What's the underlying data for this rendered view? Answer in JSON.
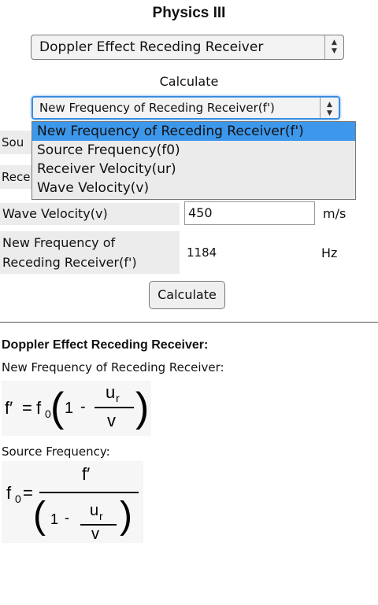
{
  "app": {
    "title": "Physics III"
  },
  "topic_select": {
    "value": "Doppler Effect Receding Receiver"
  },
  "calculate_label": "Calculate",
  "calc_select": {
    "value": "New Frequency of Receding Receiver(f')"
  },
  "dropdown": {
    "options": [
      "New Frequency of Receding Receiver(f')",
      "Source Frequency(f0)",
      "Receiver Velocity(ur)",
      "Wave Velocity(v)"
    ]
  },
  "form": {
    "row1_label_visible": "Sou",
    "row2_label_visible": "Rece",
    "wave_velocity": {
      "label": "Wave Velocity(v)",
      "value": "450",
      "unit": "m/s"
    },
    "result": {
      "label_line1": "New Frequency of",
      "label_line2": "Receding Receiver(f')",
      "value": "1184",
      "unit": "Hz"
    },
    "button": "Calculate"
  },
  "info": {
    "heading": "Doppler Effect Receding Receiver:",
    "subheading1": "New Frequency of Receding Receiver:",
    "subheading2": "Source Frequency:"
  },
  "formula1": {
    "lhs": "f′",
    "equals": "=",
    "f": "f",
    "f_sub": "0",
    "one": "1",
    "minus": "-",
    "num": "u",
    "num_sub": "r",
    "den": "v"
  },
  "formula2": {
    "lhs": "f",
    "lhs_sub": "0",
    "equals": "=",
    "num": "f′",
    "one": "1",
    "minus": "-",
    "inner_num": "u",
    "inner_num_sub": "r",
    "inner_den": "v"
  }
}
